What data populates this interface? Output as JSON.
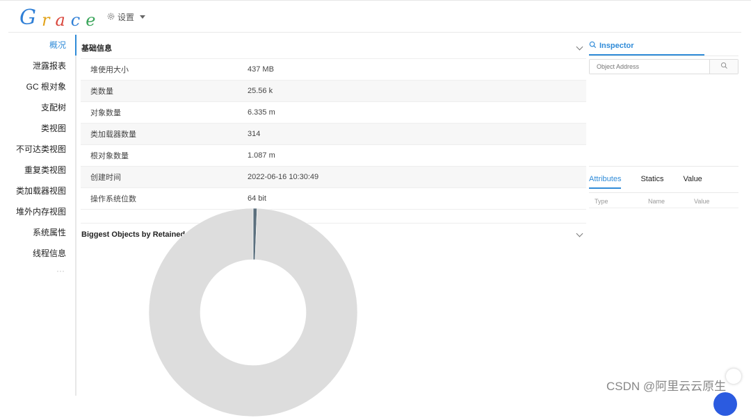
{
  "app": {
    "logo": [
      "G",
      "r",
      "a",
      "c",
      "e"
    ],
    "settings_label": "设置"
  },
  "sidebar": {
    "items": [
      {
        "label": "概况",
        "active": true
      },
      {
        "label": "泄露报表"
      },
      {
        "label": "GC 根对象"
      },
      {
        "label": "支配树"
      },
      {
        "label": "类视图"
      },
      {
        "label": "不可达类视图"
      },
      {
        "label": "重复类视图"
      },
      {
        "label": "类加载器视图"
      },
      {
        "label": "堆外内存视图"
      },
      {
        "label": "系统属性"
      },
      {
        "label": "线程信息"
      }
    ],
    "more": "···"
  },
  "basic_info": {
    "title": "基础信息",
    "rows": [
      {
        "key": "堆使用大小",
        "value": "437 MB"
      },
      {
        "key": "类数量",
        "value": "25.56 k"
      },
      {
        "key": "对象数量",
        "value": "6.335 m"
      },
      {
        "key": "类加载器数量",
        "value": "314"
      },
      {
        "key": "根对象数量",
        "value": "1.087 m"
      },
      {
        "key": "创建时间",
        "value": "2022-06-16 10:30:49"
      },
      {
        "key": "操作系统位数",
        "value": "64 bit"
      }
    ]
  },
  "biggest_objects": {
    "title": "Biggest Objects by Retained Size"
  },
  "chart_data": {
    "type": "pie",
    "title": "Biggest Objects by Retained Size",
    "slices": [
      {
        "share": 0.006,
        "color": "#5b6f7d"
      },
      {
        "share": 0.994,
        "color": "#dddddd"
      }
    ]
  },
  "inspector": {
    "tab_label": "Inspector",
    "address_placeholder": "Object Address",
    "tabs": [
      "Attributes",
      "Statics",
      "Value"
    ],
    "columns": [
      "Type",
      "Name",
      "Value"
    ]
  },
  "watermark": "CSDN @阿里云云原生",
  "colors": {
    "accent": "#2f8bd8"
  }
}
